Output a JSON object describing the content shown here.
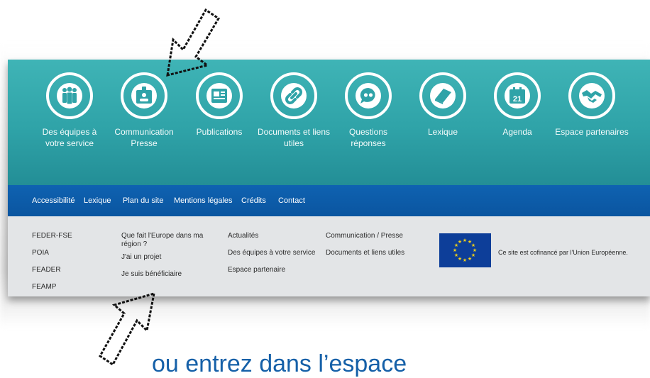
{
  "nav_icons": [
    {
      "label": "Des équipes à votre service",
      "icon": "team-icon"
    },
    {
      "label": "Communication Presse",
      "icon": "press-badge-icon"
    },
    {
      "label": "Publications",
      "icon": "newspaper-icon"
    },
    {
      "label": "Documents et liens utiles",
      "icon": "link-icon"
    },
    {
      "label": "Questions réponses",
      "icon": "quote-bubble-icon"
    },
    {
      "label": "Lexique",
      "icon": "book-icon"
    },
    {
      "label": "Agenda",
      "icon": "calendar-icon"
    },
    {
      "label": "Espace partenaires",
      "icon": "handshake-icon"
    }
  ],
  "agenda_day": "21",
  "legal_links": [
    "Accessibilité",
    "Lexique",
    "Plan du site",
    "Mentions légales",
    "Crédits",
    "Contact"
  ],
  "footer": {
    "col1": [
      "FEDER-FSE",
      "POIA",
      "FEADER",
      "FEAMP"
    ],
    "col2": [
      "Que fait l'Europe dans ma région ?",
      "J'ai un projet",
      "Je suis bénéficiaire"
    ],
    "col3": [
      "Actualités",
      "Des équipes à votre service",
      "Espace partenaire"
    ],
    "col4": [
      "Communication / Presse",
      "Documents et liens utiles"
    ],
    "eu_text": "Ce site est cofinancé par l'Union Européenne."
  },
  "caption": "ou entrez dans l’espace",
  "colors": {
    "teal": "#2fa3a8",
    "blue_bar": "#0a55a0",
    "grey": "#e3e5e7",
    "caption": "#1560a8"
  }
}
